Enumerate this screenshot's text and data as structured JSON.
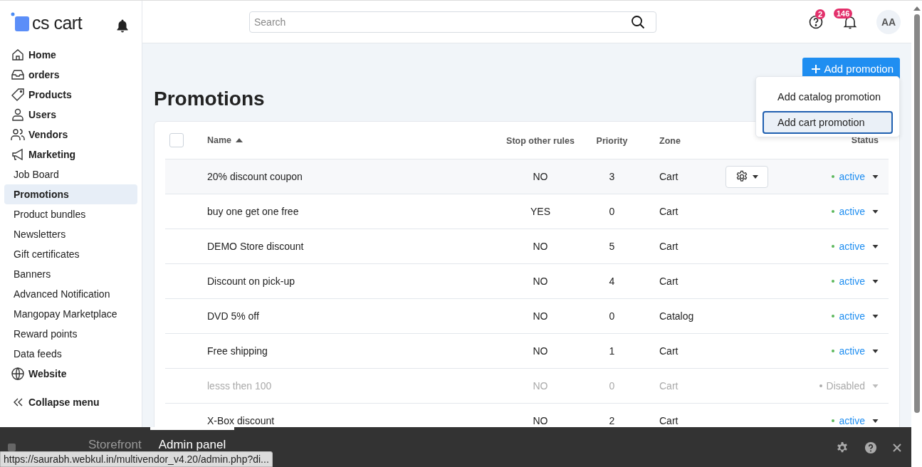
{
  "sidebar": {
    "logo": "cs cart",
    "items": [
      {
        "label": "Home",
        "kind": "main",
        "selected": false
      },
      {
        "label": "orders",
        "kind": "main",
        "selected": false
      },
      {
        "label": "Products",
        "kind": "main",
        "selected": false
      },
      {
        "label": "Users",
        "kind": "main",
        "selected": false
      },
      {
        "label": "Vendors",
        "kind": "main",
        "selected": false
      },
      {
        "label": "Marketing",
        "kind": "main",
        "selected": false
      },
      {
        "label": "Job Board",
        "kind": "sub",
        "selected": false
      },
      {
        "label": "Promotions",
        "kind": "sub",
        "selected": true
      },
      {
        "label": "Product bundles",
        "kind": "sub",
        "selected": false
      },
      {
        "label": "Newsletters",
        "kind": "sub",
        "selected": false
      },
      {
        "label": "Gift certificates",
        "kind": "sub",
        "selected": false
      },
      {
        "label": "Banners",
        "kind": "sub",
        "selected": false
      },
      {
        "label": "Advanced Notification",
        "kind": "sub",
        "selected": false
      },
      {
        "label": "Mangopay Marketplace",
        "kind": "sub",
        "selected": false
      },
      {
        "label": "Reward points",
        "kind": "sub",
        "selected": false
      },
      {
        "label": "Data feeds",
        "kind": "sub",
        "selected": false
      },
      {
        "label": "Website",
        "kind": "main",
        "selected": false
      }
    ],
    "collapse": "Collapse menu"
  },
  "header": {
    "search": {
      "placeholder": "Search"
    },
    "help_badge": "2",
    "notifications_badge": "146",
    "avatar": "AA"
  },
  "page": {
    "title": "Promotions",
    "add_button": "Add promotion",
    "menu": [
      {
        "label": "Add catalog promotion",
        "selected": false
      },
      {
        "label": "Add cart promotion",
        "selected": true
      }
    ]
  },
  "table": {
    "select_all": {
      "checked": false
    },
    "columns": [
      "Name",
      "Stop other rules",
      "Priority",
      "Zone",
      "Status"
    ],
    "rows": [
      {
        "name": "20% discount coupon",
        "stop": "NO",
        "priority": "3",
        "zone": "Cart",
        "status": "active",
        "disabled": false,
        "highlighted": true
      },
      {
        "name": "buy one get one free",
        "stop": "YES",
        "priority": "0",
        "zone": "Cart",
        "status": "active",
        "disabled": false,
        "highlighted": false
      },
      {
        "name": "DEMO Store discount",
        "stop": "NO",
        "priority": "5",
        "zone": "Cart",
        "status": "active",
        "disabled": false,
        "highlighted": false
      },
      {
        "name": "Discount on pick-up",
        "stop": "NO",
        "priority": "4",
        "zone": "Cart",
        "status": "active",
        "disabled": false,
        "highlighted": false
      },
      {
        "name": "DVD 5% off",
        "stop": "NO",
        "priority": "0",
        "zone": "Catalog",
        "status": "active",
        "disabled": false,
        "highlighted": false
      },
      {
        "name": "Free shipping",
        "stop": "NO",
        "priority": "1",
        "zone": "Cart",
        "status": "active",
        "disabled": false,
        "highlighted": false
      },
      {
        "name": "lesss then 100",
        "stop": "NO",
        "priority": "0",
        "zone": "Cart",
        "status": "Disabled",
        "disabled": true,
        "highlighted": false
      },
      {
        "name": "X-Box discount",
        "stop": "NO",
        "priority": "2",
        "zone": "Cart",
        "status": "active",
        "disabled": false,
        "highlighted": false
      }
    ]
  },
  "bottom_bar": {
    "tabs": [
      {
        "label": "Storefront",
        "selected": false
      },
      {
        "label": "Admin panel",
        "selected": true
      }
    ]
  },
  "status_url": "https://saurabh.webkul.in/multivendor_v4.20/admin.php?di..."
}
